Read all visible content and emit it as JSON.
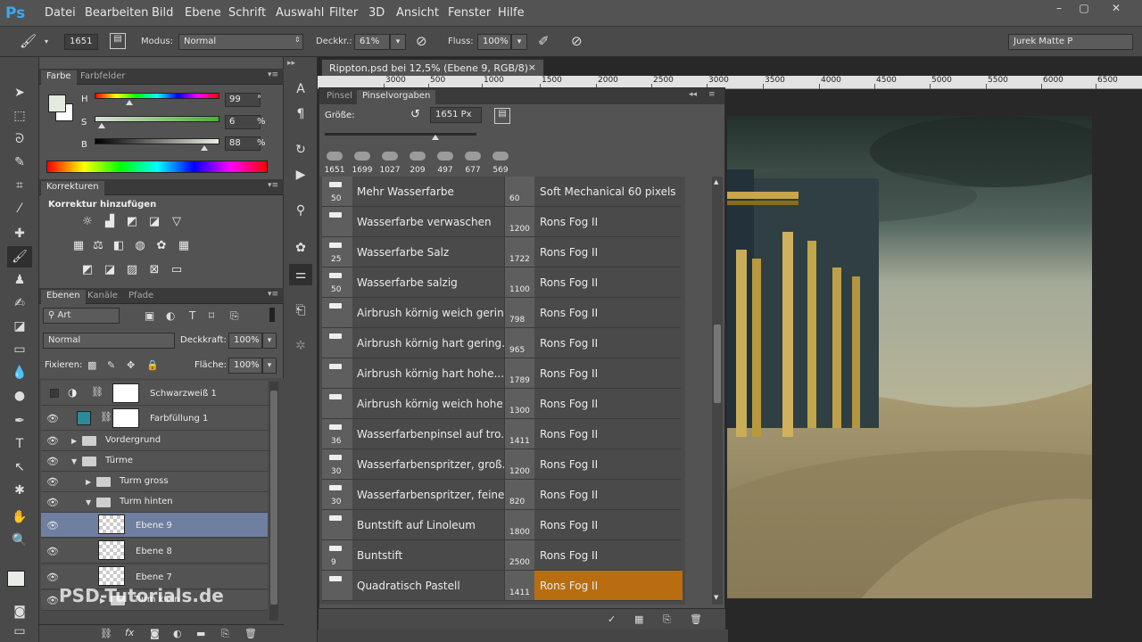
{
  "app": {
    "logo": "Ps"
  },
  "menu": [
    "Datei",
    "Bearbeiten",
    "Bild",
    "Ebene",
    "Schrift",
    "Auswahl",
    "Filter",
    "3D",
    "Ansicht",
    "Fenster",
    "Hilfe"
  ],
  "window_controls": [
    "–",
    "▢",
    "✕"
  ],
  "options": {
    "brush_size": "1651",
    "mode_label": "Modus:",
    "mode_value": "Normal",
    "opacity_label": "Deckkr.:",
    "opacity_value": "61%",
    "flow_label": "Fluss:",
    "flow_value": "100%",
    "workspace": "Jurek Matte P"
  },
  "color_panel": {
    "tabs": [
      "Farbe",
      "Farbfelder"
    ],
    "h_label": "H",
    "h_value": "99",
    "h_unit": "°",
    "s_label": "S",
    "s_value": "6",
    "s_unit": "%",
    "b_label": "B",
    "b_value": "88",
    "b_unit": "%",
    "h_fraction": 0.275,
    "s_fraction": 0.06,
    "b_fraction": 0.88
  },
  "adjustments": {
    "tab": "Korrekturen",
    "heading": "Korrektur hinzufügen"
  },
  "layers_panel": {
    "tabs": [
      "Ebenen",
      "Kanäle",
      "Pfade"
    ],
    "filter_value": "Art",
    "blend_mode": "Normal",
    "opacity_label": "Deckkraft:",
    "opacity_value": "100%",
    "lock_label": "Fixieren:",
    "fill_label": "Fläche:",
    "fill_value": "100%",
    "layers": [
      {
        "name": "Schwarzweiß 1",
        "type": "adjustment"
      },
      {
        "name": "Farbfüllung 1",
        "type": "fill"
      },
      {
        "name": "Vordergrund",
        "type": "group"
      },
      {
        "name": "Türme",
        "type": "group-open"
      },
      {
        "name": "Turm gross",
        "type": "group"
      },
      {
        "name": "Turm hinten",
        "type": "group-open"
      },
      {
        "name": "Ebene 9",
        "type": "layer",
        "selected": true
      },
      {
        "name": "Ebene 8",
        "type": "layer"
      },
      {
        "name": "Ebene 7",
        "type": "layer"
      },
      {
        "name": "Turm klein",
        "type": "group"
      }
    ]
  },
  "document": {
    "tab_title": "Rippton.psd bei 12,5% (Ebene 9, RGB/8) *",
    "tab_close": "×",
    "ruler": [
      "3000",
      "500",
      "1000",
      "1500",
      "2000",
      "2500",
      "3000",
      "3500",
      "4000",
      "4500",
      "5000",
      "5500",
      "6000",
      "6500"
    ]
  },
  "brush_panel": {
    "tabs": [
      "Pinsel",
      "Pinselvorgaben"
    ],
    "size_label": "Größe:",
    "size_value": "1651 Px",
    "size_fraction": 0.73,
    "presets": [
      "1651",
      "1699",
      "1027",
      "209",
      "497",
      "677",
      "569"
    ],
    "rows": [
      {
        "size": "50",
        "name": "Mehr Wasserfarbe",
        "size2": "60",
        "name2": "Soft Mechanical 60 pixels"
      },
      {
        "size": "",
        "name": "Wasserfarbe verwaschen",
        "size2": "1200",
        "name2": "Rons Fog II"
      },
      {
        "size": "25",
        "name": "Wasserfarbe Salz",
        "size2": "1722",
        "name2": "Rons Fog II"
      },
      {
        "size": "50",
        "name": "Wasserfarbe salzig",
        "size2": "1100",
        "name2": "Rons Fog II"
      },
      {
        "size": "",
        "name": "Airbrush körnig weich gerin...",
        "size2": "798",
        "name2": "Rons Fog II"
      },
      {
        "size": "",
        "name": "Airbrush körnig hart gering...",
        "size2": "965",
        "name2": "Rons Fog II"
      },
      {
        "size": "",
        "name": "Airbrush körnig hart hohe...",
        "size2": "1789",
        "name2": "Rons Fog II"
      },
      {
        "size": "",
        "name": "Airbrush körnig weich hohe...",
        "size2": "1300",
        "name2": "Rons Fog II"
      },
      {
        "size": "36",
        "name": "Wasserfarbenpinsel auf tro...",
        "size2": "1411",
        "name2": "Rons Fog II"
      },
      {
        "size": "30",
        "name": "Wasserfarbenspritzer, groß...",
        "size2": "1200",
        "name2": "Rons Fog II"
      },
      {
        "size": "30",
        "name": "Wasserfarbenspritzer, feine...",
        "size2": "820",
        "name2": "Rons Fog II"
      },
      {
        "size": "",
        "name": "Buntstift auf Linoleum",
        "size2": "1800",
        "name2": "Rons Fog II"
      },
      {
        "size": "9",
        "name": "Buntstift",
        "size2": "2500",
        "name2": "Rons Fog II"
      },
      {
        "size": "",
        "name": "Quadratisch Pastell",
        "size2": "1411",
        "name2": "Rons Fog II",
        "selected": true
      }
    ],
    "highlight_color": "#b86d10"
  },
  "watermark": "PSD-Tutorials.de"
}
